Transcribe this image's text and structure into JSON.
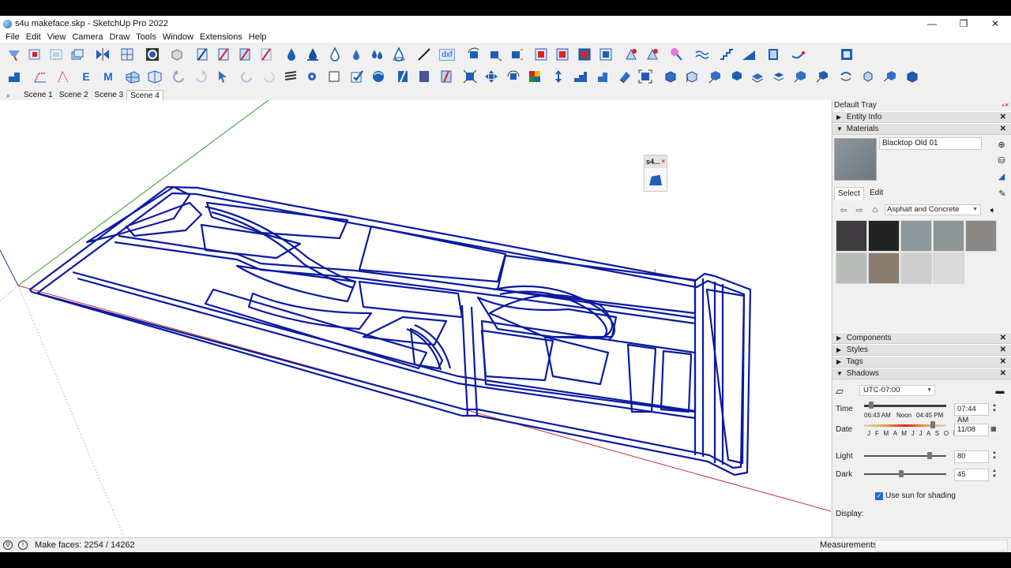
{
  "window": {
    "title": "s4u makeface.skp - SketchUp Pro 2022",
    "minimize": "—",
    "maximize": "❐",
    "close": "✕"
  },
  "menu": [
    "File",
    "Edit",
    "View",
    "Camera",
    "Draw",
    "Tools",
    "Window",
    "Extensions",
    "Help"
  ],
  "toolbar": {
    "dxf_label": "dxf",
    "entity_e": "E",
    "entity_m": "M"
  },
  "scenes": {
    "search_icon": "⌕",
    "tabs": [
      "Scene 1",
      "Scene 2",
      "Scene 3",
      "Scene 4"
    ],
    "active": 3
  },
  "float_palette": {
    "title": "s4...",
    "close": "×"
  },
  "viewport": {
    "cursor_mark": "I."
  },
  "tray": {
    "title": "Default Tray",
    "panels": {
      "entity_info": "Entity Info",
      "materials": "Materials",
      "components": "Components",
      "styles": "Styles",
      "tags": "Tags",
      "shadows": "Shadows"
    },
    "materials": {
      "current_name": "Blacktop Old 01",
      "tab_select": "Select",
      "tab_edit": "Edit",
      "library": "Asphalt and Concrete",
      "swatch_colors": [
        "#3e3c3e",
        "#232323",
        "#8d979c",
        "#8f9594",
        "#8a8785",
        "#b7bcb7",
        "#8a7c6c",
        "#cfcfcf",
        "#dadada"
      ]
    },
    "shadows": {
      "timezone": "UTC-07:00",
      "time_label": "Time",
      "time_start": "06:43 AM",
      "time_mid": "Noon",
      "time_end": "04:45 PM",
      "time_value": "07:44 AM",
      "date_label": "Date",
      "months": "J F M A M J J A S O N D",
      "date_value": "11/08",
      "light_label": "Light",
      "light_value": "80",
      "dark_label": "Dark",
      "dark_value": "45",
      "use_sun": "Use sun for shading",
      "display_label": "Display:"
    }
  },
  "status": {
    "message": "Make faces: 2254 / 14262",
    "measurements_label": "Measurements"
  }
}
